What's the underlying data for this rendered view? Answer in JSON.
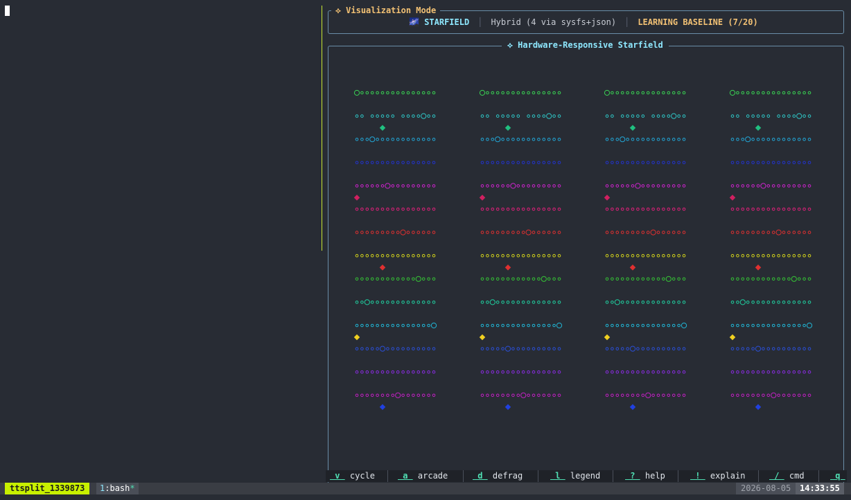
{
  "viz_mode": {
    "title": "⟡ Visualization Mode",
    "icon": "🌌",
    "name": "STARFIELD",
    "mode": "Hybrid (4 via sysfs+json)",
    "learning": "LEARNING BASELINE (7/20)"
  },
  "starfield": {
    "title": "⟡ Hardware-Responsive Starfield",
    "row_colors": [
      "#39d353",
      "#2ec7c7",
      "#22a6d6",
      "#2233cc",
      "#cc22cc",
      "#e0207a",
      "#e03030",
      "#d4d41a",
      "#35c435",
      "#20d0a0",
      "#20b8d8",
      "#2a4fd8",
      "#8a2be2",
      "#c020c0"
    ]
  },
  "hints": [
    {
      "key": "v",
      "desc": "cycle"
    },
    {
      "key": "a",
      "desc": "arcade"
    },
    {
      "key": "d",
      "desc": "defrag"
    },
    {
      "key": "l",
      "desc": "legend"
    },
    {
      "key": "?",
      "desc": "help"
    },
    {
      "key": "!",
      "desc": "explain"
    },
    {
      "key": "/",
      "desc": "cmd"
    },
    {
      "key": "q",
      "desc": ""
    }
  ],
  "tmux": {
    "session": "ttsplit_1339873",
    "window_index": "1",
    "window_sep": ":",
    "window_name": "bash",
    "window_flag": "*",
    "date": "2026-08-05",
    "time": "14:33:55"
  }
}
